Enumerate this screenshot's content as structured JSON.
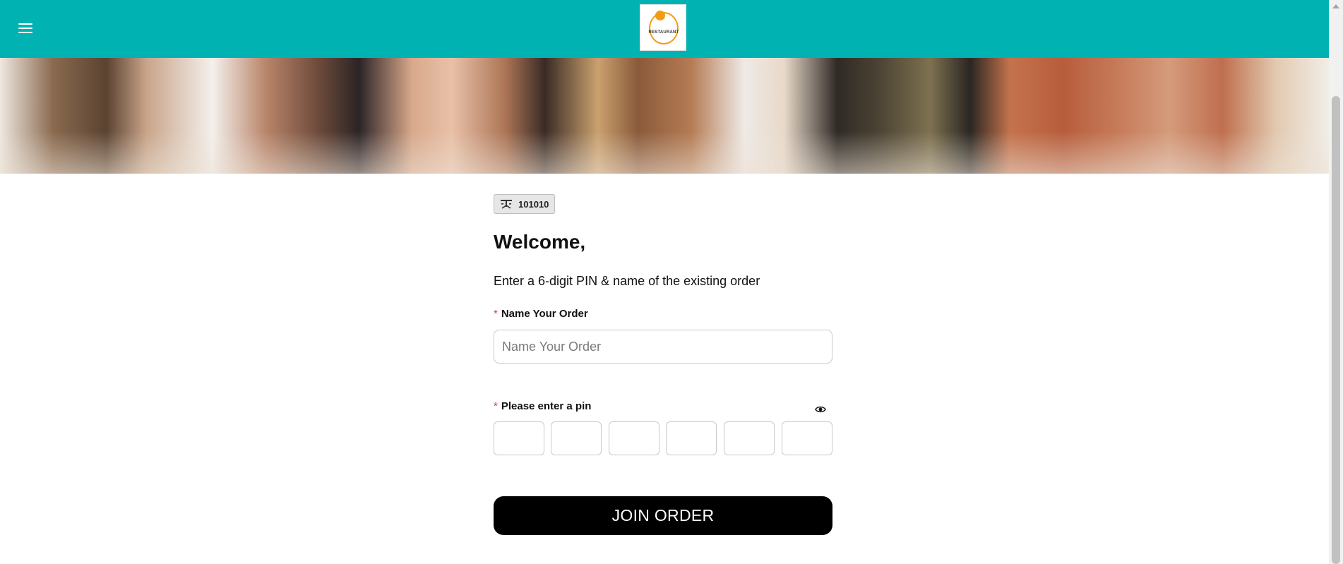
{
  "header": {
    "menu_icon": "hamburger-menu-icon",
    "logo_text": "RESTAURANT",
    "background_color": "#00b2b2"
  },
  "banner": {
    "image": "restaurant-interior-blurred-photo"
  },
  "table_badge": {
    "icon": "table-icon",
    "number": "101010"
  },
  "welcome": {
    "title": "Welcome,",
    "subtitle": "Enter a 6-digit PIN & name of the existing order"
  },
  "order_name": {
    "required_mark": "*",
    "label": "Name Your Order",
    "placeholder": "Name Your Order",
    "value": ""
  },
  "pin": {
    "required_mark": "*",
    "label": "Please enter a pin",
    "toggle_icon": "eye-icon",
    "digits": [
      "",
      "",
      "",
      "",
      "",
      ""
    ]
  },
  "join_button": {
    "label": "JOIN ORDER",
    "background_color": "#000000"
  }
}
